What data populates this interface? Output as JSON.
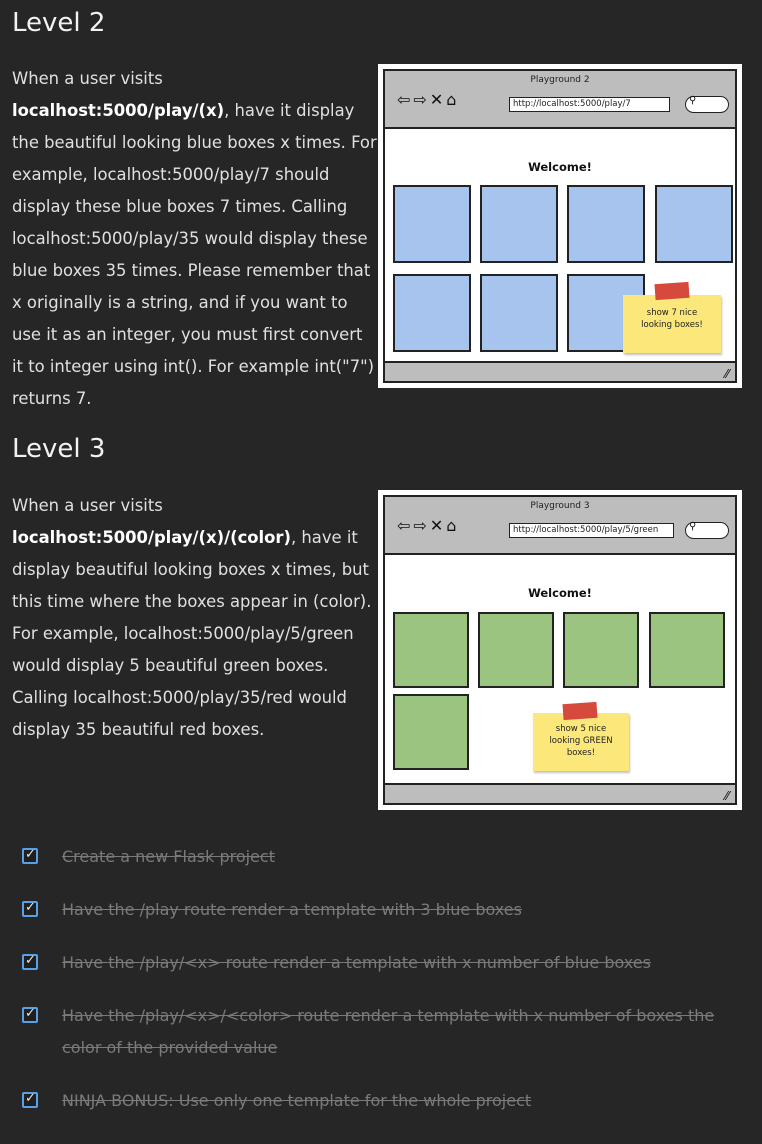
{
  "level2": {
    "heading": "Level 2",
    "p1": "When a user visits ",
    "p1_bold": "localhost:5000/play/(x)",
    "p1_rest": ", have it display the beautiful looking blue boxes x times. For example, localhost:5000/play/7 should display these blue boxes 7 times. Calling localhost:5000/play/35 would display these blue boxes 35 times. Please remember that x originally is a string, and if you want to use it as an integer, you must first convert it to integer using int(). For example int(\"7\") returns 7.",
    "mock": {
      "title": "Playground 2",
      "url": "http://localhost:5000/play/7",
      "welcome": "Welcome!",
      "note": "show 7 nice looking boxes!",
      "box_color": "#a6c4ee",
      "box_count": 7
    }
  },
  "level3": {
    "heading": "Level 3",
    "p1": "When a user visits ",
    "p1_bold": "localhost:5000/play/(x)/(color)",
    "p1_rest": ", have it display beautiful looking boxes x times, but this time where the boxes appear in (color). For example, localhost:5000/play/5/green would display 5 beautiful green boxes. Calling localhost:5000/play/35/red would display 35 beautiful red boxes.",
    "mock": {
      "title": "Playground 3",
      "url": "http://localhost:5000/play/5/green",
      "welcome": "Welcome!",
      "note": "show 5 nice looking GREEN boxes!",
      "box_color": "#9ac47f",
      "box_count": 5
    }
  },
  "checklist": [
    {
      "label": "Create a new Flask project",
      "checked": true
    },
    {
      "label": "Have the /play route render a template with 3 blue boxes",
      "checked": true
    },
    {
      "label": "Have the /play/<x> route render a template with x number of blue boxes",
      "checked": true
    },
    {
      "label": "Have the /play/<x>/<color> route render a template with x number of boxes the color of the provided value",
      "checked": true
    },
    {
      "label": "NINJA BONUS: Use only one template for the whole project",
      "checked": true
    }
  ],
  "icons": {
    "back": "arrow-left-icon",
    "forward": "arrow-right-icon",
    "close": "close-icon",
    "home": "home-icon",
    "search": "search-icon",
    "checkbox": "checkmark-icon"
  },
  "colors": {
    "background": "#262626",
    "checkbox_border": "#5aa0e6",
    "done_text": "#7a7a7a"
  }
}
